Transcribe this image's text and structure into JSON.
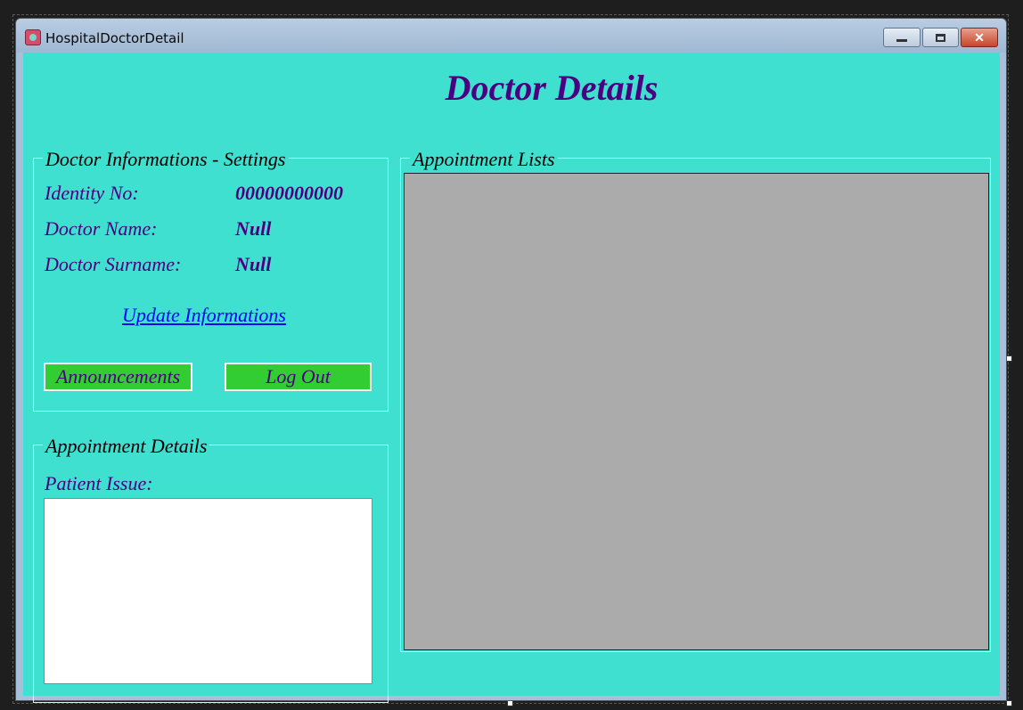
{
  "window": {
    "title": "HospitalDoctorDetail",
    "icon": "hospital-app-icon",
    "controls": {
      "minimize": "minimize-icon",
      "maximize": "maximize-icon",
      "close": "close-icon"
    }
  },
  "page": {
    "heading": "Doctor Details"
  },
  "doctor_group": {
    "legend": "Doctor Informations - Settings",
    "identity_label": "Identity No:",
    "identity_value": "00000000000",
    "name_label": "Doctor Name:",
    "name_value": "Null",
    "surname_label": "Doctor Surname:",
    "surname_value": "Null",
    "update_link": "Update Informations",
    "announcements_button": "Announcements",
    "logout_button": "Log Out"
  },
  "appointment_details": {
    "legend": "Appointment Details",
    "patient_issue_label": "Patient Issue:",
    "patient_issue_value": ""
  },
  "appointment_lists": {
    "legend": "Appointment Lists"
  },
  "colors": {
    "background": "#40e0d0",
    "heading": "#4b0082",
    "button": "#32cd32",
    "link": "#0000ff",
    "grid": "#ababab"
  }
}
